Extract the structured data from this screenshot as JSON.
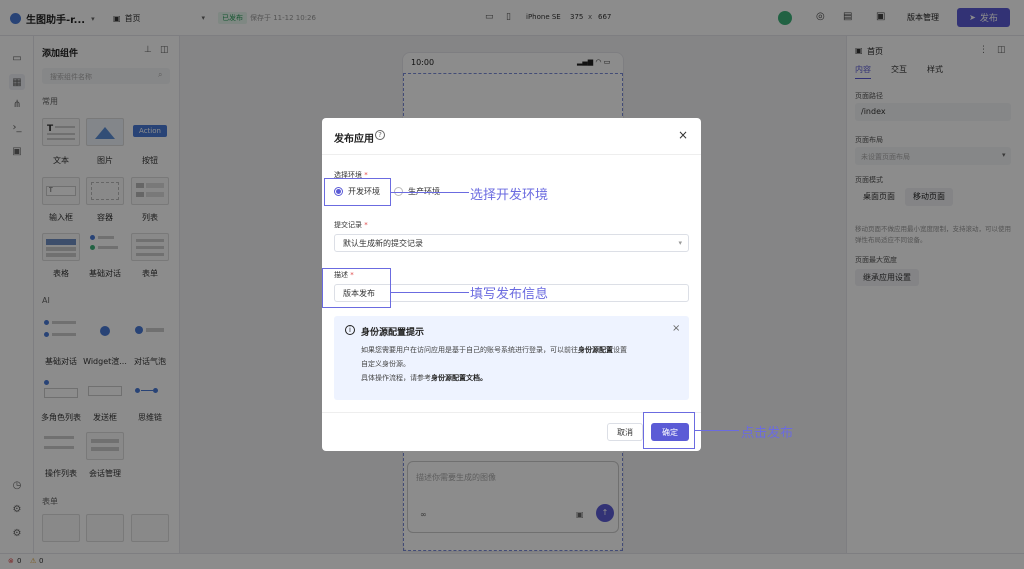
{
  "topbar": {
    "app_name": "生图助手-r...",
    "page_select": "首页",
    "published_badge": "已发布",
    "saved_text": "保存于 11-12 10:26",
    "device_name": "iPhone SE",
    "width": "375",
    "x": "x",
    "height": "667",
    "version_button": "版本管理",
    "publish_button": "发布"
  },
  "left_panel": {
    "title": "添加组件",
    "search_placeholder": "搜索组件名称",
    "section_common": "常用",
    "section_ai": "AI",
    "section_form": "表单",
    "common_items": [
      "文本",
      "图片",
      "按钮",
      "输入框",
      "容器",
      "列表",
      "表格",
      "基础对话",
      "表单"
    ],
    "action_label": "Action",
    "ai_items": [
      "基础对话",
      "Widget渲...",
      "对话气泡",
      "多角色列表",
      "发送框",
      "思维链",
      "操作列表",
      "会话管理"
    ]
  },
  "right_panel": {
    "page_name": "首页",
    "tabs": [
      "内容",
      "交互",
      "样式"
    ],
    "page_path_label": "页面路径",
    "page_path_value": "/index",
    "page_layout_label": "页面布局",
    "page_layout_placeholder": "未设置页面布局",
    "page_mode_label": "页面模式",
    "mode_desktop": "桌面页面",
    "mode_mobile": "移动页面",
    "mode_note": "移动页面不做应用最小宽度限制，支持滚动，可以使用弹性布局适应不同设备。",
    "max_width_label": "页面最大宽度",
    "inherit_button": "继承应用设置"
  },
  "phone": {
    "time": "10:00",
    "chat_placeholder": "描述你需要生成的图像"
  },
  "modal": {
    "title": "发布应用",
    "env_label": "选择环境",
    "env_dev": "开发环境",
    "env_prod": "生产环境",
    "commit_label": "提交记录",
    "commit_value": "默认生成新的提交记录",
    "desc_label": "描述",
    "desc_value": "版本发布",
    "required_mark": "*",
    "info_title": "身份源配置提示",
    "info_line1": "如果您需要用户在访问应用是基于自己的账号系统进行登录，可以前往",
    "info_link1": "身份源配置",
    "info_line1_end": "设置",
    "info_line2": "自定义身份源。",
    "info_line3": "具体操作流程，请参考",
    "info_link2": "身份源配置文档。",
    "cancel": "取消",
    "confirm": "确定"
  },
  "annotations": {
    "env": "选择开发环境",
    "desc": "填写发布信息",
    "publish": "点击发布"
  },
  "statusbar": {
    "errors": "0",
    "warnings": "0"
  },
  "colors": {
    "accent": "#5b5bd6",
    "annotation": "#6b6be0",
    "info_bg": "#eef3ff"
  }
}
